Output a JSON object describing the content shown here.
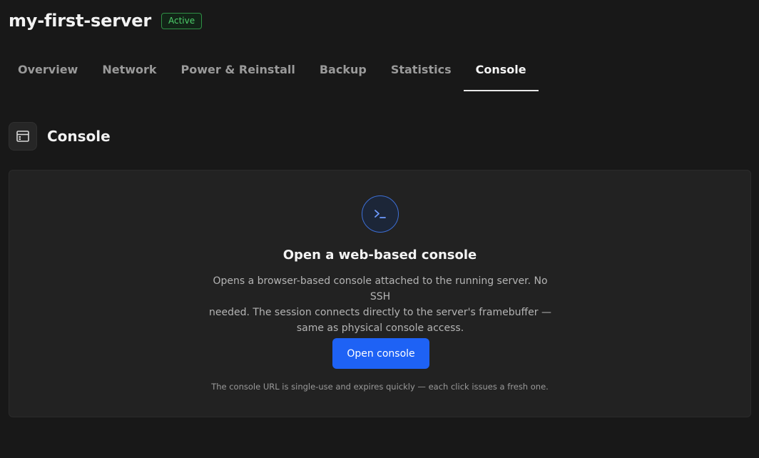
{
  "server": {
    "name": "my-first-server",
    "status": "Active"
  },
  "tabs": [
    {
      "label": "Overview",
      "active": false
    },
    {
      "label": "Network",
      "active": false
    },
    {
      "label": "Power & Reinstall",
      "active": false
    },
    {
      "label": "Backup",
      "active": false
    },
    {
      "label": "Statistics",
      "active": false
    },
    {
      "label": "Console",
      "active": true
    }
  ],
  "section": {
    "title": "Console",
    "icon": "browser-window-icon"
  },
  "panel": {
    "icon": "terminal-prompt-icon",
    "title": "Open a web-based console",
    "description_lines": [
      "Opens a browser-based console attached to the running server. No SSH",
      "needed. The session connects directly to the server's framebuffer —",
      "same as physical console access."
    ],
    "button_label": "Open console",
    "note": "The console URL is single-use and expires quickly — each click issues a fresh one."
  },
  "colors": {
    "background": "#181818",
    "panel": "#222222",
    "accent": "#1e62f5",
    "status_green": "#4ecf6b"
  }
}
